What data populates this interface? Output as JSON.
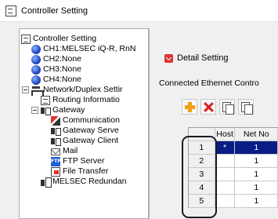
{
  "window": {
    "title": "Controller Setting",
    "icon": "controller-setting-icon"
  },
  "tree": {
    "items": [
      {
        "label": "Controller Setting",
        "icon": "controller-setting-icon",
        "expanded": true
      },
      {
        "label": "CH1:MELSEC iQ-R, RnN",
        "icon": "globe-icon"
      },
      {
        "label": "CH2:None",
        "icon": "globe-icon"
      },
      {
        "label": "CH3:None",
        "icon": "globe-icon"
      },
      {
        "label": "CH4:None",
        "icon": "globe-icon"
      },
      {
        "label": "Network/Duplex Settir",
        "icon": "network-icon",
        "expanded": true
      },
      {
        "label": "Routing Informatio",
        "icon": "routing-icon"
      },
      {
        "label": "Gateway",
        "icon": "gateway-icon",
        "expanded": true
      },
      {
        "label": "Communication",
        "icon": "communication-icon"
      },
      {
        "label": "Gateway Serve",
        "icon": "gateway-server-icon"
      },
      {
        "label": "Gateway Client",
        "icon": "gateway-client-icon"
      },
      {
        "label": "Mail",
        "icon": "mail-icon"
      },
      {
        "label": "FTP Server",
        "icon": "ftp-icon",
        "icon_text": "FTP"
      },
      {
        "label": "File Transfer",
        "icon": "file-transfer-icon"
      },
      {
        "label": "MELSEC Redundan",
        "icon": "redundant-icon"
      }
    ]
  },
  "panel": {
    "detail_label": "Detail Setting",
    "connected_label": "Connected Ethernet Contro"
  },
  "toolbar": {
    "buttons": [
      "add-icon",
      "delete-icon",
      "copy-icon",
      "paste-icon"
    ]
  },
  "grid": {
    "headers": [
      "",
      "Host",
      "Net No"
    ],
    "rows": [
      {
        "num": "1",
        "host": "*",
        "net": "1",
        "selected": true
      },
      {
        "num": "2",
        "host": "",
        "net": "1",
        "selected": false
      },
      {
        "num": "3",
        "host": "",
        "net": "1",
        "selected": false
      },
      {
        "num": "4",
        "host": "",
        "net": "1",
        "selected": false
      },
      {
        "num": "5",
        "host": "",
        "net": "1",
        "selected": false
      }
    ]
  },
  "colors": {
    "selection": "#0a1d86",
    "accent_red": "#d33333",
    "add_orange": "#f3a014"
  }
}
